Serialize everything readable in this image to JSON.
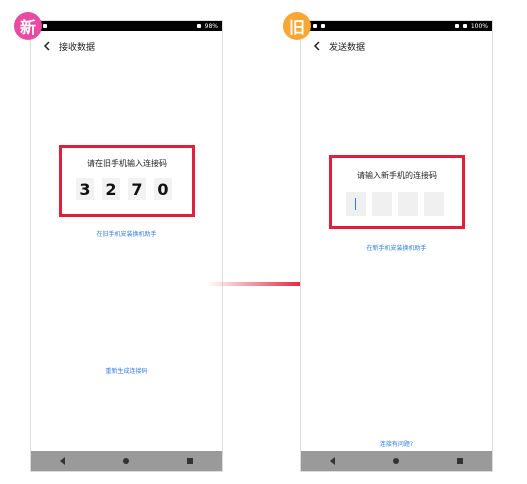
{
  "badges": {
    "new": "新",
    "old": "旧"
  },
  "new_phone": {
    "title": "接收数据",
    "prompt": "请在旧手机输入连接码",
    "code_digits": [
      "3",
      "2",
      "7",
      "0"
    ],
    "install_link": "在旧手机安装换机助手",
    "regenerate_link": "重新生成连接码",
    "battery": "98%"
  },
  "old_phone": {
    "title": "发送数据",
    "prompt": "请输入新手机的连接码",
    "install_link": "在新手机安装换机助手",
    "help_link": "连接有问题?",
    "battery": "100%"
  },
  "colors": {
    "highlight": "#e0203a",
    "link": "#2f7de1",
    "badge_new": "#e94aa4",
    "badge_old": "#f7a733"
  }
}
